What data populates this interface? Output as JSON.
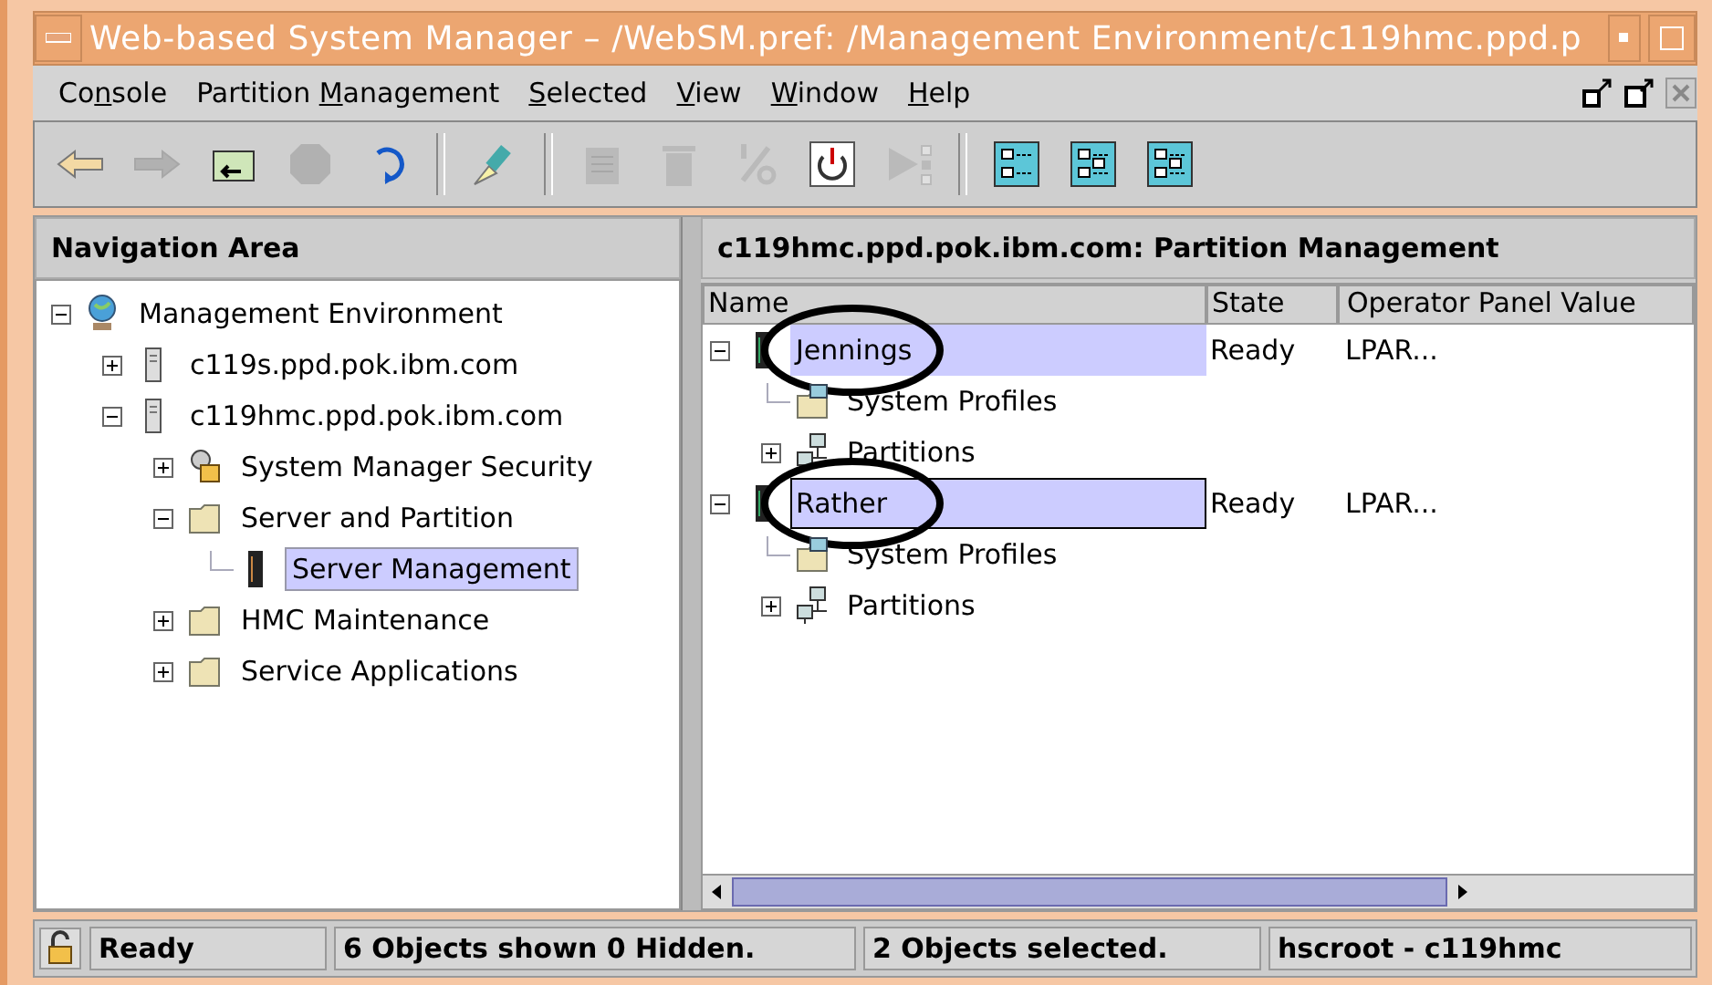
{
  "window": {
    "title": "Web-based System Manager – /WebSM.pref: /Management Environment/c119hmc.ppd.p"
  },
  "menu": [
    {
      "before": "Co",
      "mnemonic": "n",
      "after": "sole"
    },
    {
      "before": "Partition ",
      "mnemonic": "M",
      "after": "anagement"
    },
    {
      "mnemonic": "S",
      "after": "elected"
    },
    {
      "mnemonic": "V",
      "after": "iew"
    },
    {
      "mnemonic": "W",
      "after": "indow"
    },
    {
      "mnemonic": "H",
      "after": "elp"
    }
  ],
  "toolbar": [
    {
      "kind": "back",
      "disabled": false
    },
    {
      "kind": "forward",
      "disabled": true
    },
    {
      "kind": "up",
      "disabled": false
    },
    {
      "kind": "stop",
      "disabled": true
    },
    {
      "kind": "reload",
      "disabled": false
    },
    {
      "kind": "sep"
    },
    {
      "kind": "find",
      "disabled": false
    },
    {
      "kind": "sep"
    },
    {
      "kind": "properties",
      "disabled": true
    },
    {
      "kind": "delete",
      "disabled": true
    },
    {
      "kind": "percent",
      "disabled": true
    },
    {
      "kind": "power",
      "disabled": false
    },
    {
      "kind": "run",
      "disabled": true
    },
    {
      "kind": "sep"
    },
    {
      "kind": "view-list",
      "disabled": false
    },
    {
      "kind": "view-tree",
      "disabled": false
    },
    {
      "kind": "view-details",
      "disabled": false
    }
  ],
  "navigation": {
    "title": "Navigation Area",
    "tree": [
      {
        "label": "Management Environment",
        "kind": "globe",
        "expanded": true,
        "selected": false,
        "children": [
          {
            "label": "c119s.ppd.pok.ibm.com",
            "kind": "server",
            "expanded": false,
            "selected": false
          },
          {
            "label": "c119hmc.ppd.pok.ibm.com",
            "kind": "server",
            "expanded": true,
            "selected": false,
            "children": [
              {
                "label": "System Manager Security",
                "kind": "keys",
                "expanded": false,
                "selected": false
              },
              {
                "label": "Server and Partition",
                "kind": "folder",
                "expanded": true,
                "selected": false,
                "children": [
                  {
                    "label": "Server Management",
                    "kind": "rack",
                    "selected": true
                  }
                ]
              },
              {
                "label": "HMC Maintenance",
                "kind": "folder",
                "expanded": false,
                "selected": false
              },
              {
                "label": "Service Applications",
                "kind": "folder",
                "expanded": false,
                "selected": false
              }
            ]
          }
        ]
      }
    ]
  },
  "content": {
    "title": "c119hmc.ppd.pok.ibm.com: Partition Management",
    "columns": [
      "Name",
      "State",
      "Operator Panel Value"
    ],
    "rows": [
      {
        "name": "Jennings",
        "kind": "rack",
        "state": "Ready",
        "value": "LPAR...",
        "expanded": true,
        "selected": true,
        "focused": false,
        "circled": true,
        "children": [
          {
            "name": "System Profiles",
            "kind": "profiles",
            "selected": false
          },
          {
            "name": "Partitions",
            "kind": "network",
            "expanded": false,
            "selected": false
          }
        ]
      },
      {
        "name": "Rather",
        "kind": "rack",
        "state": "Ready",
        "value": "LPAR...",
        "expanded": true,
        "selected": true,
        "focused": true,
        "circled": true,
        "children": [
          {
            "name": "System Profiles",
            "kind": "profiles",
            "selected": false
          },
          {
            "name": "Partitions",
            "kind": "network",
            "expanded": false,
            "selected": false
          }
        ]
      }
    ]
  },
  "status_bar": [
    "Ready",
    "6 Objects shown 0 Hidden.",
    "2 Objects selected.",
    "hscroot - c119hmc"
  ]
}
